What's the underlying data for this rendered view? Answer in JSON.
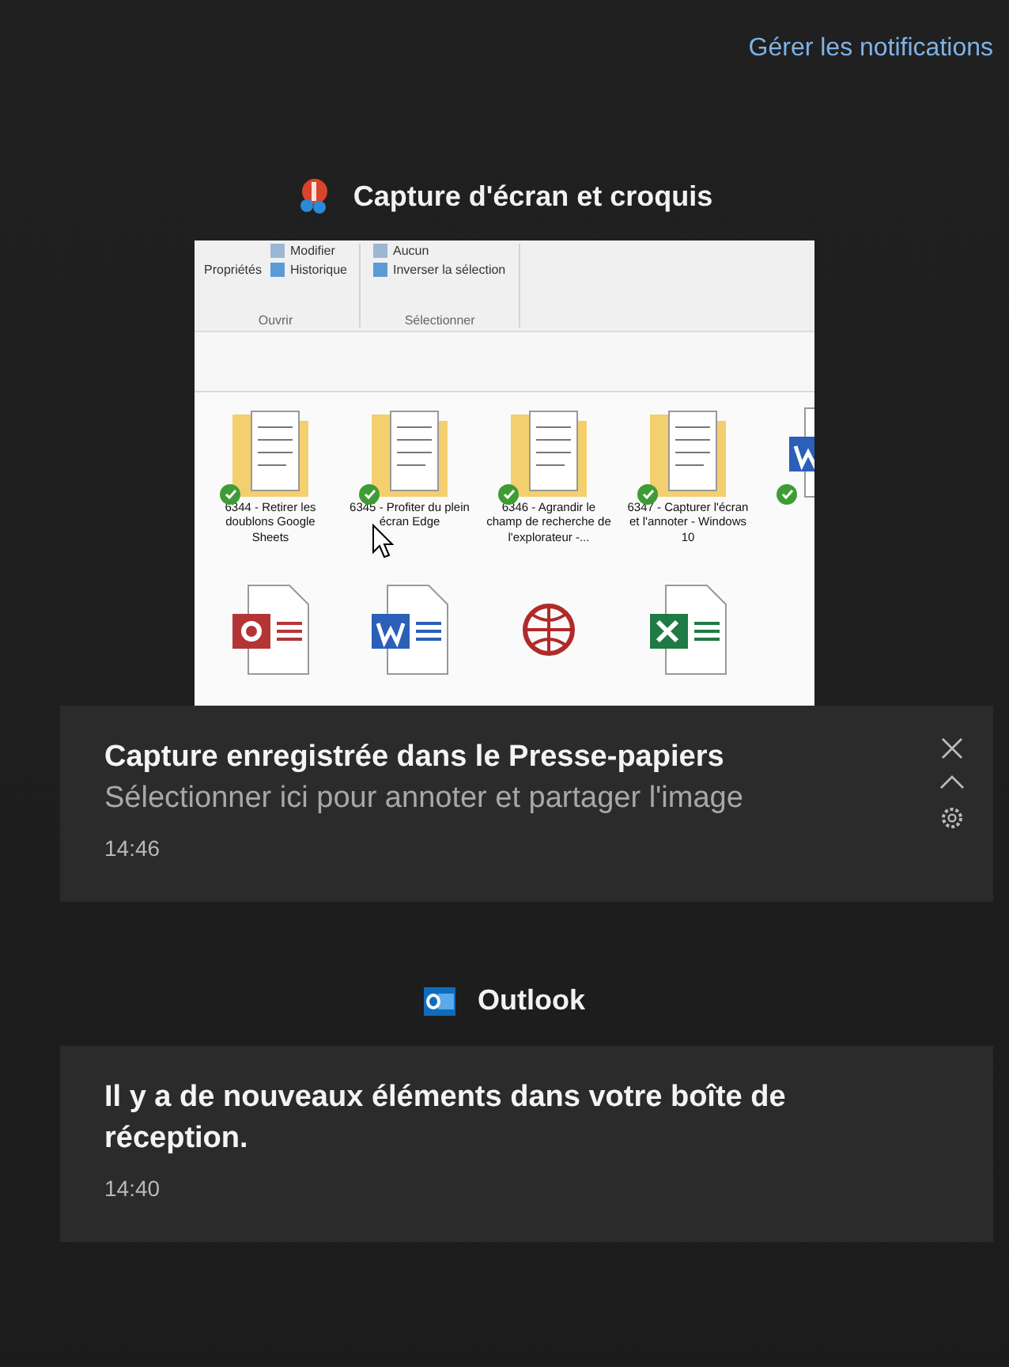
{
  "header": {
    "manage_link": "Gérer les notifications"
  },
  "groups": [
    {
      "app": "Capture d'écran et croquis",
      "notifications": [
        {
          "title": "Capture enregistrée dans le Presse-papiers",
          "body": "Sélectionner ici pour annoter et partager l'image",
          "time": "14:46",
          "preview": {
            "ribbon": [
              {
                "label": "Ouvrir",
                "big": "Propriétés",
                "items": [
                  "Modifier",
                  "Historique"
                ]
              },
              {
                "label": "Sélectionner",
                "items": [
                  "Aucun",
                  "Inverser la sélection"
                ]
              }
            ],
            "files": [
              {
                "kind": "folder",
                "name": "6344 - Retirer les doublons Google Sheets",
                "synced": true
              },
              {
                "kind": "folder",
                "name": "6345 - Profiter du plein écran Edge",
                "synced": true
              },
              {
                "kind": "folder",
                "name": "6346 - Agrandir le champ de recherche de l'explorateur -...",
                "synced": true
              },
              {
                "kind": "folder",
                "name": "6347 - Capturer l'écran et l'annoter - Windows 10",
                "synced": true
              },
              {
                "kind": "word",
                "synced": true
              },
              {
                "kind": "access"
              },
              {
                "kind": "word"
              },
              {
                "kind": "web"
              },
              {
                "kind": "excel"
              }
            ]
          }
        }
      ]
    },
    {
      "app": "Outlook",
      "notifications": [
        {
          "title": "Il y a de nouveaux éléments dans votre boîte de réception.",
          "time": "14:40"
        }
      ]
    }
  ]
}
